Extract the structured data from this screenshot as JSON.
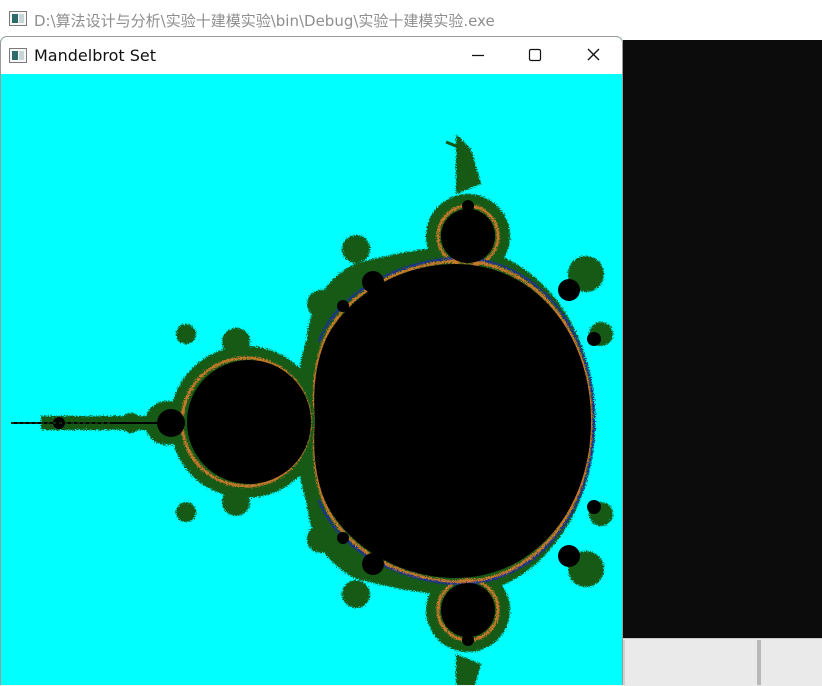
{
  "background_window": {
    "title": "D:\\算法设计与分析\\实验十建模实验\\bin\\Debug\\实验十建模实验.exe",
    "icon": "app-window-icon"
  },
  "main_window": {
    "title": "Mandelbrot Set",
    "icon": "app-window-icon",
    "controls": {
      "minimize": "minimize-icon",
      "maximize": "maximize-icon",
      "close": "close-icon"
    }
  },
  "colors": {
    "background_fill": "#00ffff",
    "set_interior": "#000000",
    "boundary_green": "#145a14",
    "boundary_orange": "#c8782a",
    "boundary_blue": "#1e2f9a",
    "console_bg": "#0c0c0c"
  }
}
